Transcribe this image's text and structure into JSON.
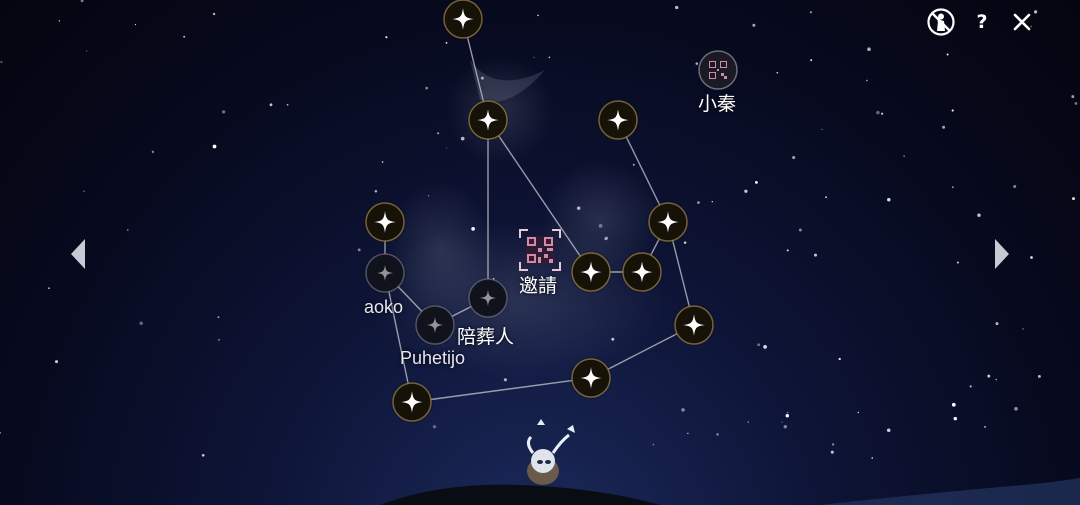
{
  "top_bar": {
    "icons": [
      "silhouette-crossed-icon",
      "help-icon",
      "close-icon"
    ],
    "help_label": "?",
    "close_label": "✕"
  },
  "navigation": {
    "left_icon": "chevron-left-icon",
    "right_icon": "chevron-right-icon"
  },
  "friends": {
    "xiao_qin": {
      "name": "小秦",
      "icon": "qr-code-icon"
    },
    "invite": {
      "label": "邀請",
      "icon": "qr-code-icon"
    },
    "aoko": {
      "name": "aoko"
    },
    "funeral": {
      "name": "陪葬人"
    },
    "puhetijo": {
      "name": "Puhetijo"
    }
  },
  "colors": {
    "sky_dark": "#04050f",
    "sky_mid": "#0d1436",
    "node_ring": "#c9a45a",
    "node_star": "#ffffff",
    "link_line": "#c8c8d0",
    "qr_accent": "#d28aa8"
  }
}
